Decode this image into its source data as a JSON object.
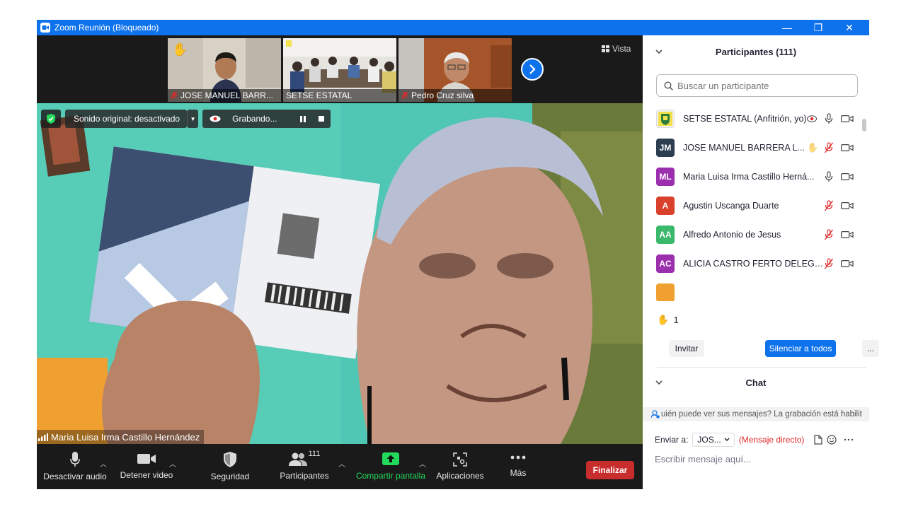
{
  "window": {
    "title": "Zoom Reunión (Bloqueado)",
    "controls": {
      "minimize": "—",
      "restore": "❐",
      "close": "✕"
    }
  },
  "video": {
    "view_label": "Vista",
    "thumbnails": [
      {
        "name": "JOSE MANUEL BARR...",
        "muted": true,
        "hand_raised": true
      },
      {
        "name": "SETSE ESTATAL",
        "muted": false
      },
      {
        "name": "Pedro Cruz silva",
        "muted": true
      }
    ],
    "original_sound": "Sonido original: desactivado",
    "recording": "Grabando...",
    "active_speaker": "Maria Luisa Irma Castillo Hernández"
  },
  "toolbar": {
    "mute": "Desactivar audio",
    "video": "Detener video",
    "security": "Seguridad",
    "participants": "Participantes",
    "participants_count": "111",
    "share": "Compartir pantalla",
    "apps": "Aplicaciones",
    "more": "Más",
    "end": "Finalizar"
  },
  "panel": {
    "participants_title": "Participantes (111)",
    "search_placeholder": "Buscar un participante",
    "participants": [
      {
        "initials": "",
        "name": "SETSE ESTATAL (Anfitrión, yo)",
        "color": "#f0f0f0",
        "muted": false,
        "recording": true,
        "hand": false
      },
      {
        "initials": "JM",
        "name": "JOSE MANUEL BARRERA L...",
        "color": "#2d3e50",
        "muted": true,
        "recording": false,
        "hand": true
      },
      {
        "initials": "ML",
        "name": "Maria Luisa Irma Castillo Herná...",
        "color": "#9b2fae",
        "muted": false,
        "recording": false,
        "hand": false
      },
      {
        "initials": "A",
        "name": "Agustin Uscanga Duarte",
        "color": "#d9412c",
        "muted": true,
        "recording": false,
        "hand": false
      },
      {
        "initials": "AA",
        "name": "Alfredo Antonio de Jesus",
        "color": "#3ab86b",
        "muted": true,
        "recording": false,
        "hand": false
      },
      {
        "initials": "AC",
        "name": "ALICIA CASTRO FERTO DELEGAC...",
        "color": "#9b2fae",
        "muted": true,
        "recording": false,
        "hand": false
      }
    ],
    "raised_hands": "1",
    "invite": "Invitar",
    "mute_all": "Silenciar a todos",
    "more": "...",
    "chat_title": "Chat",
    "chat_notice": "uién puede ver sus mensajes? La grabación está habilit",
    "send_to_label": "Enviar a:",
    "send_to_value": "JOS...",
    "direct_message": "(Mensaje directo)",
    "message_placeholder": "Escribir mensaje aquí..."
  },
  "colors": {
    "brand_blue": "#0e72ed",
    "end_red": "#c82d2d",
    "share_green": "#23d959",
    "muted_red": "#e02828"
  }
}
